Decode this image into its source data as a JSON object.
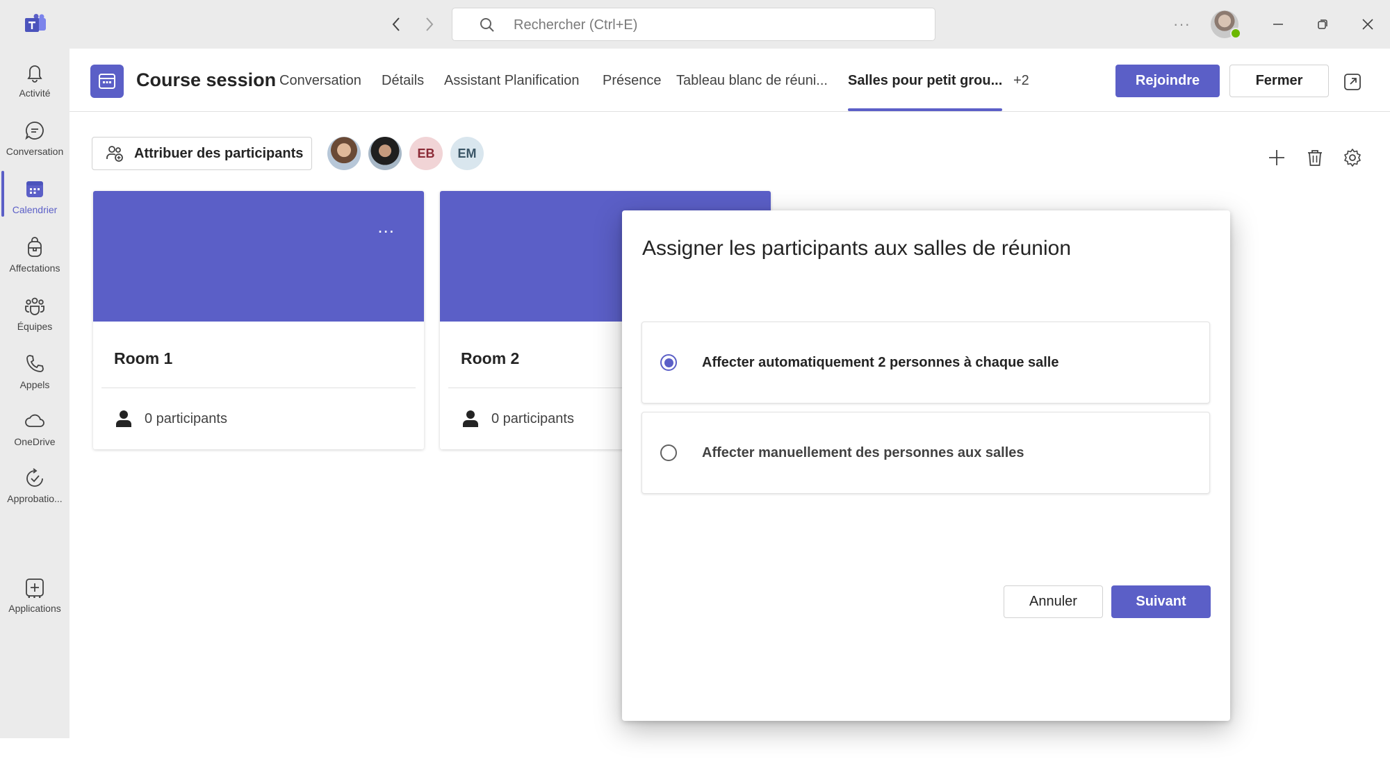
{
  "search": {
    "placeholder": "Rechercher (Ctrl+E)"
  },
  "rail": {
    "items": [
      {
        "label": "Activité",
        "icon": "bell-icon"
      },
      {
        "label": "Conversation",
        "icon": "chat-icon"
      },
      {
        "label": "Calendrier",
        "icon": "calendar-icon"
      },
      {
        "label": "Affectations",
        "icon": "backpack-icon"
      },
      {
        "label": "Équipes",
        "icon": "teams-icon"
      },
      {
        "label": "Appels",
        "icon": "phone-icon"
      },
      {
        "label": "OneDrive",
        "icon": "cloud-icon"
      },
      {
        "label": "Approbatio...",
        "icon": "approvals-icon"
      },
      {
        "label": "Applications",
        "icon": "add-app-icon"
      }
    ],
    "more": "..."
  },
  "meeting": {
    "title": "Course session",
    "tabs": [
      "Conversation",
      "Détails",
      "Assistant Planification",
      "Présence",
      "Tableau blanc de réuni...",
      "Salles pour petit grou...",
      "+2"
    ],
    "join_label": "Rejoindre",
    "close_label": "Fermer"
  },
  "toolbar": {
    "assign_label": "Attribuer des participants",
    "avatars": [
      "EB",
      "EM"
    ]
  },
  "rooms": [
    {
      "name": "Room 1",
      "participants": "0 participants",
      "more": "..."
    },
    {
      "name": "Room 2",
      "participants": "0 participants"
    }
  ],
  "dialog": {
    "title": "Assigner les participants aux salles de réunion",
    "option_auto": "Affecter automatiquement 2 personnes à chaque salle",
    "option_manual": "Affecter manuellement des personnes aux salles",
    "cancel_label": "Annuler",
    "next_label": "Suivant"
  },
  "colors": {
    "accent": "#5b5fc7",
    "rail_bg": "#ebebeb",
    "presence": "#6bb700"
  }
}
